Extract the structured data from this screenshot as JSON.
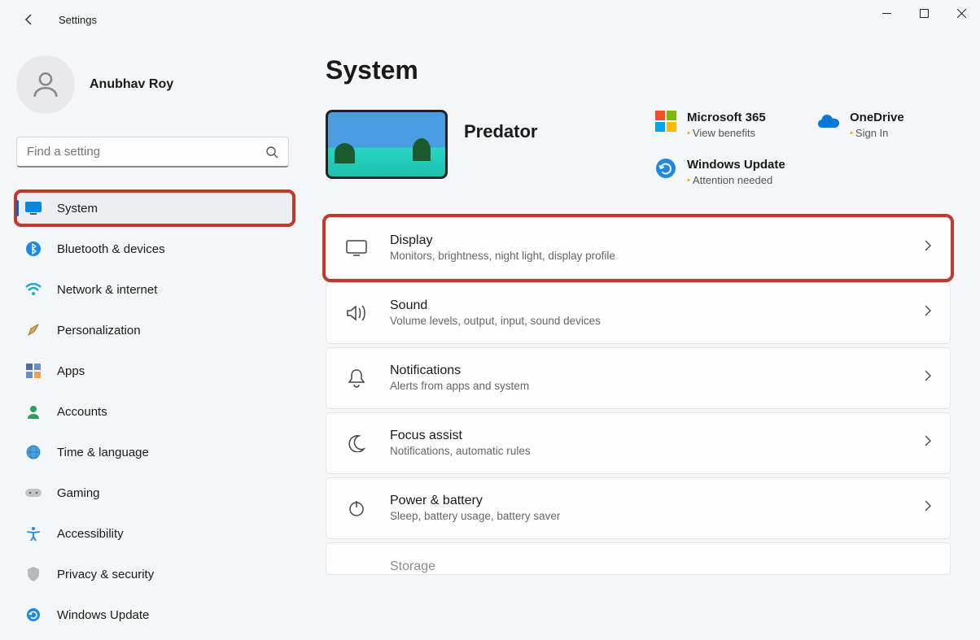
{
  "app": {
    "title": "Settings"
  },
  "user": {
    "name": "Anubhav Roy"
  },
  "search": {
    "placeholder": "Find a setting"
  },
  "sidebar": {
    "items": [
      {
        "label": "System"
      },
      {
        "label": "Bluetooth & devices"
      },
      {
        "label": "Network & internet"
      },
      {
        "label": "Personalization"
      },
      {
        "label": "Apps"
      },
      {
        "label": "Accounts"
      },
      {
        "label": "Time & language"
      },
      {
        "label": "Gaming"
      },
      {
        "label": "Accessibility"
      },
      {
        "label": "Privacy & security"
      },
      {
        "label": "Windows Update"
      }
    ]
  },
  "main": {
    "page_title": "System",
    "pc_name": "Predator",
    "tiles": {
      "m365": {
        "title": "Microsoft 365",
        "sub": "View benefits"
      },
      "onedrive": {
        "title": "OneDrive",
        "sub": "Sign In"
      },
      "update": {
        "title": "Windows Update",
        "sub": "Attention needed"
      }
    },
    "cards": [
      {
        "title": "Display",
        "sub": "Monitors, brightness, night light, display profile"
      },
      {
        "title": "Sound",
        "sub": "Volume levels, output, input, sound devices"
      },
      {
        "title": "Notifications",
        "sub": "Alerts from apps and system"
      },
      {
        "title": "Focus assist",
        "sub": "Notifications, automatic rules"
      },
      {
        "title": "Power & battery",
        "sub": "Sleep, battery usage, battery saver"
      },
      {
        "title": "Storage",
        "sub": ""
      }
    ]
  }
}
